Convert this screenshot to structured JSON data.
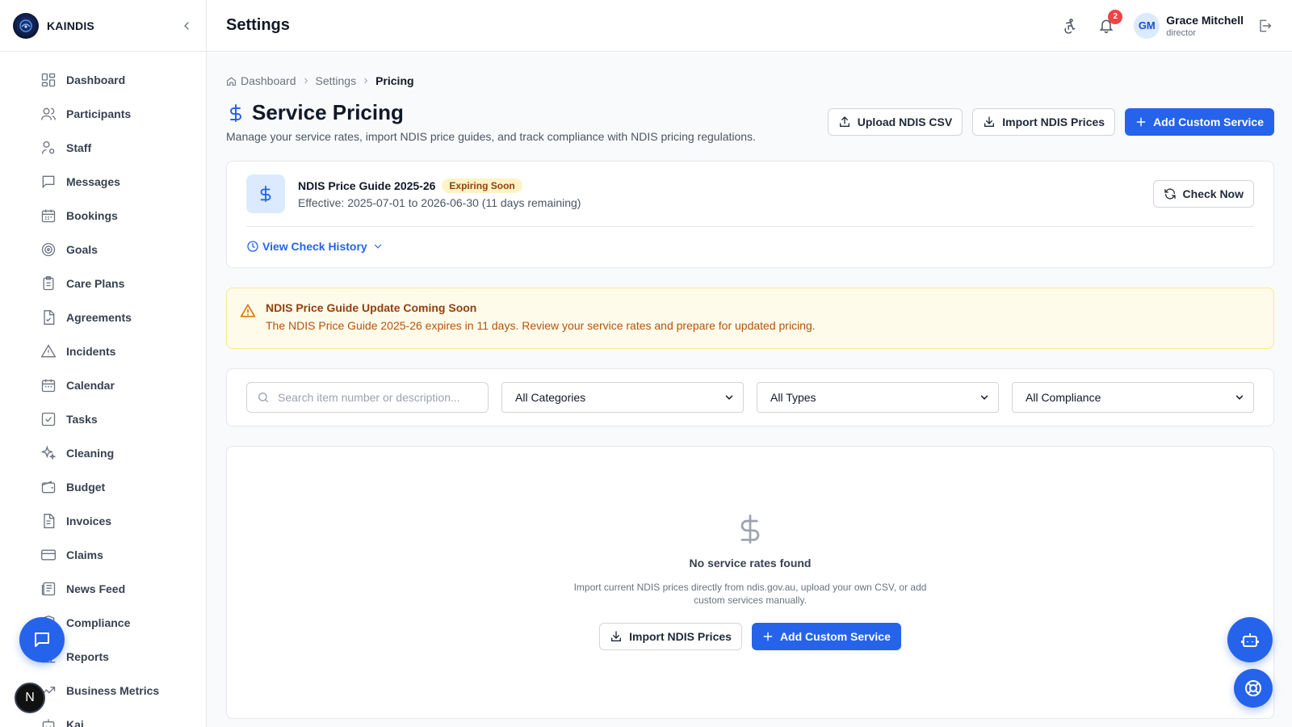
{
  "app": {
    "brand": "KAINDIS"
  },
  "nav": [
    {
      "label": "Dashboard",
      "icon": "dashboard-icon"
    },
    {
      "label": "Participants",
      "icon": "users-icon"
    },
    {
      "label": "Staff",
      "icon": "user-cog-icon"
    },
    {
      "label": "Messages",
      "icon": "message-icon"
    },
    {
      "label": "Bookings",
      "icon": "calendar-icon"
    },
    {
      "label": "Goals",
      "icon": "target-icon"
    },
    {
      "label": "Care Plans",
      "icon": "clipboard-icon"
    },
    {
      "label": "Agreements",
      "icon": "file-check-icon"
    },
    {
      "label": "Incidents",
      "icon": "warning-icon"
    },
    {
      "label": "Calendar",
      "icon": "calendar-icon"
    },
    {
      "label": "Tasks",
      "icon": "check-square-icon"
    },
    {
      "label": "Cleaning",
      "icon": "sparkles-icon"
    },
    {
      "label": "Budget",
      "icon": "wallet-icon"
    },
    {
      "label": "Invoices",
      "icon": "file-text-icon"
    },
    {
      "label": "Claims",
      "icon": "credit-card-icon"
    },
    {
      "label": "News Feed",
      "icon": "newspaper-icon"
    },
    {
      "label": "Compliance",
      "icon": "shield-icon"
    },
    {
      "label": "Reports",
      "icon": "chart-icon"
    },
    {
      "label": "Business Metrics",
      "icon": "trending-icon"
    },
    {
      "label": "Kai",
      "icon": "bot-icon"
    }
  ],
  "topbar": {
    "title": "Settings",
    "notification_count": "2",
    "user": {
      "initials": "GM",
      "name": "Grace Mitchell",
      "role": "director"
    }
  },
  "breadcrumb": {
    "home": "Dashboard",
    "section": "Settings",
    "current": "Pricing"
  },
  "page": {
    "title": "Service Pricing",
    "description": "Manage your service rates, import NDIS price guides, and track compliance with NDIS pricing regulations.",
    "actions": {
      "upload": "Upload NDIS CSV",
      "import": "Import NDIS Prices",
      "add": "Add Custom Service"
    }
  },
  "guide": {
    "title": "NDIS Price Guide 2025-26",
    "badge": "Expiring Soon",
    "effective": "Effective: 2025-07-01 to 2026-06-30 (11 days remaining)",
    "check_now": "Check Now",
    "history": "View Check History"
  },
  "alert": {
    "title": "NDIS Price Guide Update Coming Soon",
    "message": "The NDIS Price Guide 2025-26 expires in 11 days. Review your service rates and prepare for updated pricing."
  },
  "filters": {
    "search_placeholder": "Search item number or description...",
    "category": "All Categories",
    "type": "All Types",
    "compliance": "All Compliance"
  },
  "empty": {
    "title": "No service rates found",
    "description": "Import current NDIS prices directly from ndis.gov.au, upload your own CSV, or add custom services manually.",
    "import": "Import NDIS Prices",
    "add": "Add Custom Service"
  },
  "misc": {
    "n_badge": "N"
  },
  "colors": {
    "primary": "#2563eb",
    "warning_bg": "#fffbeb",
    "warning_text": "#92400e",
    "badge_red": "#ef4444"
  }
}
